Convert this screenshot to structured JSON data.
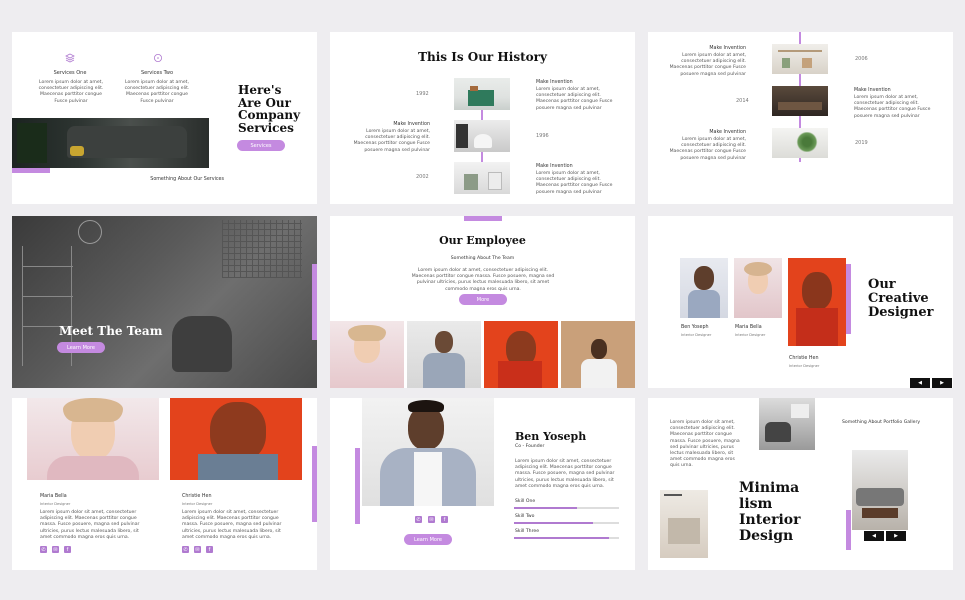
{
  "slide1": {
    "service_one": "Services One",
    "service_two": "Services Two",
    "body": "Lorem ipsum dolor at amet, consectetuer adipiscing elit. Maecenas porttitor congue Fusce pulvinar",
    "body2": "Lorem ipsum dolor at amet, consectetuer adipiscing elit. Maecenas porttitor congue Fusce pulvinar",
    "title": "Here's Are Our Company Services",
    "button": "Services",
    "caption": "Something About Our Services"
  },
  "slide2": {
    "title": "This Is Our History",
    "years": [
      "1992",
      "1996",
      "2002"
    ],
    "item_title": "Make Invention",
    "item_body": "Lorem ipsum dolor at amet, consectetuer adipiscing elit. Maecenas porttitor congue Fusce posuere magna sed pulvinar"
  },
  "slide3": {
    "years": [
      "2006",
      "2014",
      "2019"
    ],
    "item_title": "Make Invention",
    "item_body": "Lorem ipsum dolor at amet, consectetuer adipiscing elit. Maecenas porttitor congue Fusce posuere magna sed pulvinar"
  },
  "slide4": {
    "title": "Meet The Team",
    "button": "Learn More"
  },
  "slide5": {
    "title": "Our Employee",
    "subtitle": "Something About The Team",
    "body": "Lorem ipsum dolor at amet, consectetuer adipiscing elit. Maecenas porttitor congue massa. Fusce posuere, magna sed pulvinar ultricies, purus lectus malesuada libero, sit amet commodo magna eros quis urna.",
    "button": "More"
  },
  "slide6": {
    "title": "Our Creative Designer",
    "people": [
      {
        "name": "Ben Yoseph",
        "role": "Interior Designer"
      },
      {
        "name": "Maria Bella",
        "role": "Interior Designer"
      },
      {
        "name": "Christie Hen",
        "role": "Interior Designer"
      }
    ],
    "prev": "◀",
    "next": "▶"
  },
  "slide7": {
    "people": [
      {
        "name": "Maria Bella",
        "role": "Interior Designer"
      },
      {
        "name": "Christie Hen",
        "role": "Interior Designer"
      }
    ],
    "body": "Lorem ipsum dolor sit amet, consectetuer adipiscing elit. Maecenas porttitor congue massa. Fusce posuere, magna sed pulvinar ultricies, purus lectus malesuada libero, sit amet commodo magna eros quis urna."
  },
  "slide8": {
    "name": "Ben Yoseph",
    "role": "Co - Founder",
    "body": "Lorem ipsum dolor sit amet, consectetuer adipiscing elit. Maecenas porttitor congue massa. Fusce posuere, magna sed pulvinar ultricies, purus lectus malesuada libero, sit amet commodo magna eros quis urna.",
    "skills": [
      {
        "label": "Skill One",
        "level": 0.6
      },
      {
        "label": "Skill Two",
        "level": 0.75
      },
      {
        "label": "Skill Three",
        "level": 0.9
      }
    ],
    "button": "Learn More"
  },
  "slide9": {
    "body": "Lorem ipsum dolor sit amet, consectetuer adipiscing elit. Maecenas porttitor congue massa. Fusce posuere, magna sed pulvinar ultricies, purus lectus malesuada libero, sit amet commodo magna eros quis urna.",
    "caption": "Something About Portfolio Gallery",
    "title": "Minima lism Interior Design",
    "prev": "◀",
    "next": "▶"
  },
  "colors": {
    "accent": "#c48ae0",
    "background": "#eeedf0"
  }
}
